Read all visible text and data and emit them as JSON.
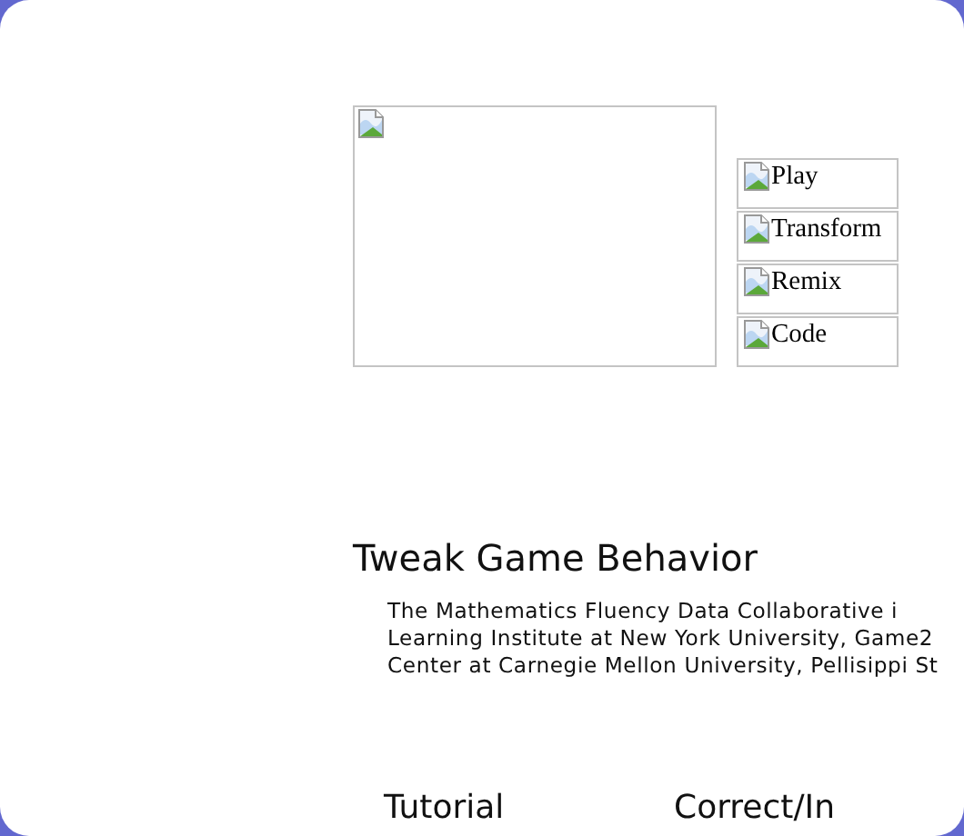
{
  "buttons": [
    {
      "label": "Play"
    },
    {
      "label": "Transform"
    },
    {
      "label": "Remix"
    },
    {
      "label": "Code"
    }
  ],
  "heading": "Tweak Game Behavior",
  "description_lines": [
    "The Mathematics Fluency Data Collaborative i",
    "Learning Institute at New York University, Game2",
    "Center at Carnegie Mellon University, Pellisippi St"
  ],
  "bottom_labels": [
    "Tutorial",
    "Correct/In"
  ]
}
